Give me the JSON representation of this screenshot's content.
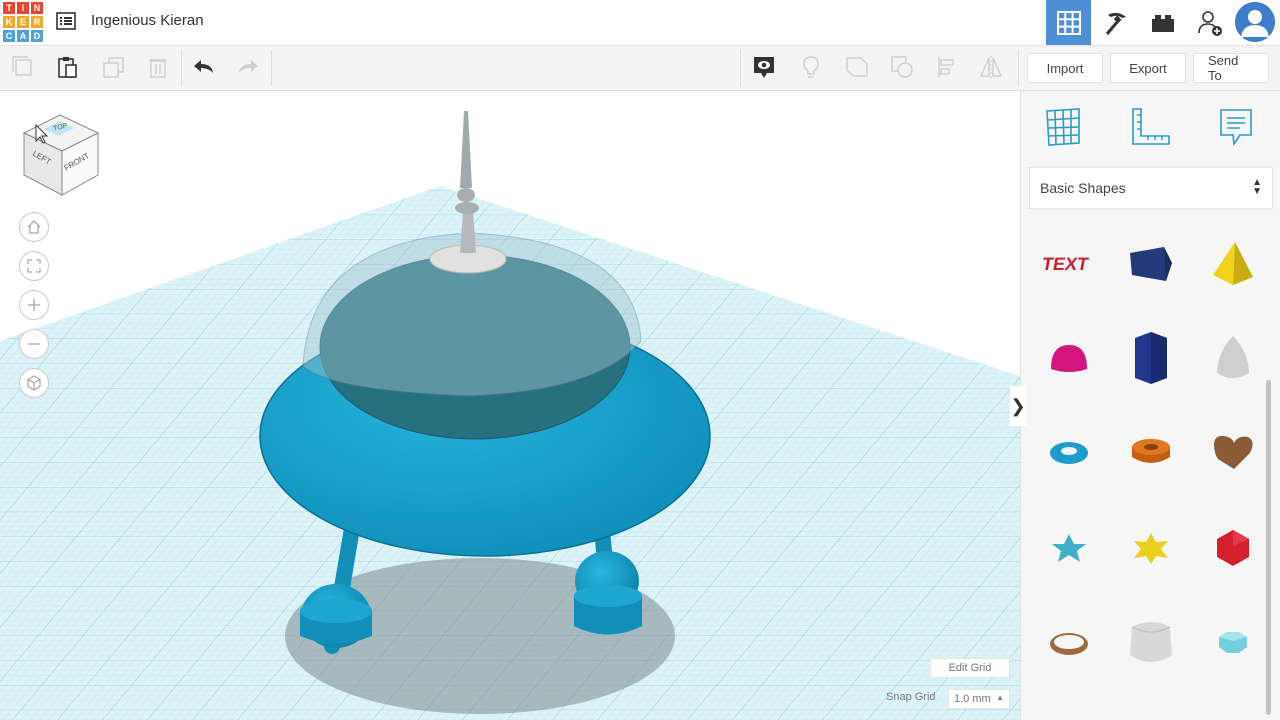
{
  "app": {
    "logo_letters": [
      "T",
      "I",
      "N",
      "K",
      "E",
      "R",
      "C",
      "A",
      "D"
    ],
    "logo_colors": [
      "#e8452c",
      "#e8452c",
      "#e8452c",
      "#f0a92d",
      "#f0a92d",
      "#f0a92d",
      "#4fa3d8",
      "#4fa3d8",
      "#4fa3d8"
    ],
    "design_name": "Ingenious Kieran",
    "accent": "#4f8fd6"
  },
  "header": {
    "buttons": [
      "3d-design-grid-icon",
      "pickaxe-icon",
      "lego-brick-icon",
      "add-user-icon"
    ],
    "avatar": "user-avatar"
  },
  "toolbar": {
    "import_label": "Import",
    "export_label": "Export",
    "sendto_label": "Send To"
  },
  "viewcube": {
    "top": "TOP",
    "left": "LEFT",
    "front": "FRONT"
  },
  "nav_buttons": [
    "home-view-icon",
    "fit-view-icon",
    "zoom-in-icon",
    "zoom-out-icon",
    "perspective-icon"
  ],
  "grid": {
    "edit_grid_label": "Edit Grid",
    "snap_grid_label": "Snap Grid",
    "snap_grid_value": "1.0 mm"
  },
  "panel": {
    "tools": [
      "workplane-icon",
      "ruler-icon",
      "notes-icon"
    ],
    "category": "Basic Shapes",
    "shapes": [
      {
        "name": "text",
        "color": "#c7202f"
      },
      {
        "name": "box",
        "color": "#23397a"
      },
      {
        "name": "pyramid",
        "color": "#f3d21b"
      },
      {
        "name": "half-sphere",
        "color": "#d4147f"
      },
      {
        "name": "polygon",
        "color": "#24378d"
      },
      {
        "name": "paraboloid",
        "color": "#cfcfcf"
      },
      {
        "name": "torus",
        "color": "#1a9ccc"
      },
      {
        "name": "tube",
        "color": "#e0761f"
      },
      {
        "name": "heart",
        "color": "#8b5a36"
      },
      {
        "name": "star",
        "color": "#3fb0c6"
      },
      {
        "name": "star-six",
        "color": "#e9cf1e"
      },
      {
        "name": "icosahedron",
        "color": "#d51f2f"
      },
      {
        "name": "ring",
        "color": "#9c6a3d"
      },
      {
        "name": "round-roof",
        "color": "#d8d8d8"
      },
      {
        "name": "diamond",
        "color": "#74d0df"
      }
    ]
  }
}
